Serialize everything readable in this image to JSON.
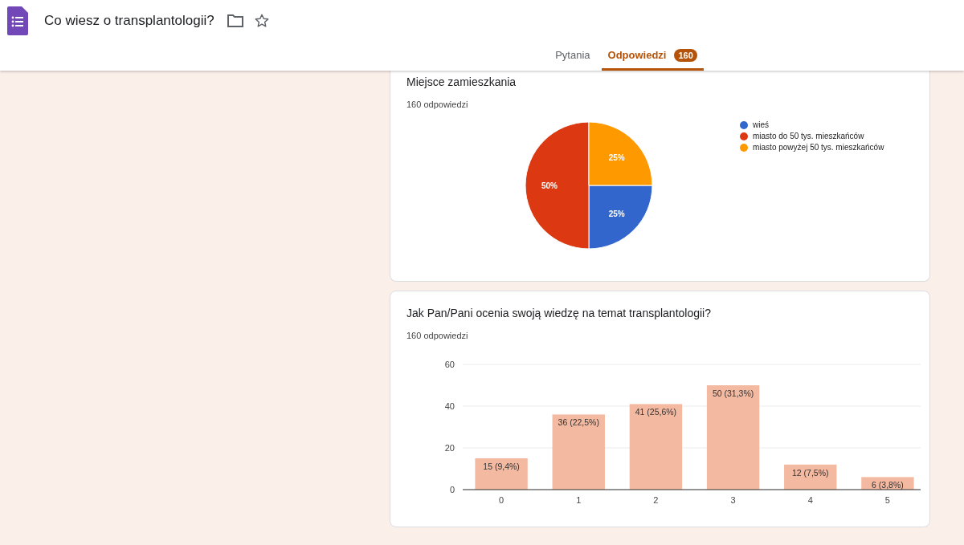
{
  "header": {
    "title": "Co wiesz o transplantologii?"
  },
  "tabs": [
    {
      "label": "Pytania",
      "selected": false
    },
    {
      "label": "Odpowiedzi",
      "selected": true,
      "count": "160"
    }
  ],
  "questions": [
    {
      "title": "Miejsce zamieszkania",
      "responses": "160 odpowiedzi",
      "chart_data": {
        "type": "pie",
        "categories": [
          "wieś",
          "miasto do 50 tys. mieszkańców",
          "miasto powyżej 50 tys. mieszkańców"
        ],
        "values": [
          25,
          50,
          25
        ],
        "legend": "right",
        "colors": [
          "#3366cc",
          "#dc3912",
          "#ff9900"
        ],
        "value_labels": [
          "25%",
          "50%",
          "25%"
        ]
      }
    },
    {
      "title": "Jak Pan/Pani ocenia swoją wiedzę na temat transplantologii?",
      "responses": "160 odpowiedzi",
      "chart_data": {
        "type": "bar",
        "categories": [
          "0",
          "1",
          "2",
          "3",
          "4",
          "5"
        ],
        "series": [
          {
            "color": "#f4b9a1",
            "values": [
              15,
              36,
              41,
              50,
              12,
              6
            ]
          }
        ],
        "ylim": [
          0,
          60
        ],
        "yticks": [
          0,
          20,
          40,
          60
        ],
        "value_labels": [
          "15 (9,4%)",
          "36 (22,5%)",
          "41 (25,6%)",
          "50 (31,3%)",
          "12 (7,5%)",
          "6 (3,8%)"
        ]
      }
    }
  ]
}
